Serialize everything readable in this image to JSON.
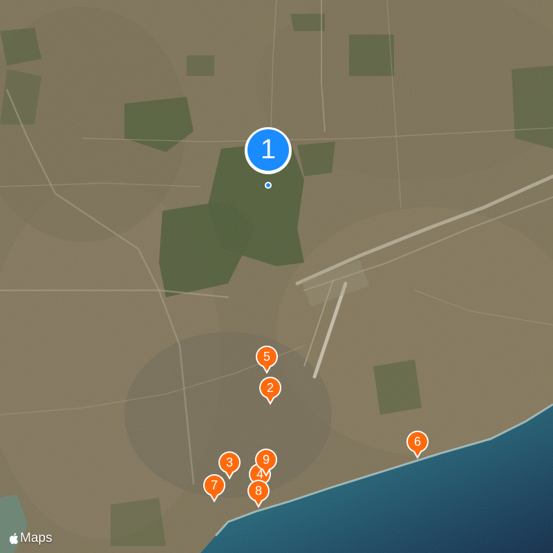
{
  "map": {
    "style": "satellite",
    "land_color": "#7c7155",
    "park_color": "#4a5a34",
    "water_color": "#1f6a78",
    "deep_water_color": "#0d2a48"
  },
  "attribution": {
    "label": "Maps",
    "icon": "apple-logo-icon"
  },
  "colors": {
    "primary_pin": "#1a8cff",
    "secondary_pin": "#ff6a0d"
  },
  "markers": [
    {
      "label": "1",
      "kind": "primary"
    },
    {
      "label": "5",
      "kind": "secondary"
    },
    {
      "label": "2",
      "kind": "secondary"
    },
    {
      "label": "6",
      "kind": "secondary"
    },
    {
      "label": "3",
      "kind": "secondary"
    },
    {
      "label": "9",
      "kind": "secondary"
    },
    {
      "label": "4",
      "kind": "secondary"
    },
    {
      "label": "7",
      "kind": "secondary"
    },
    {
      "label": "8",
      "kind": "secondary"
    }
  ]
}
